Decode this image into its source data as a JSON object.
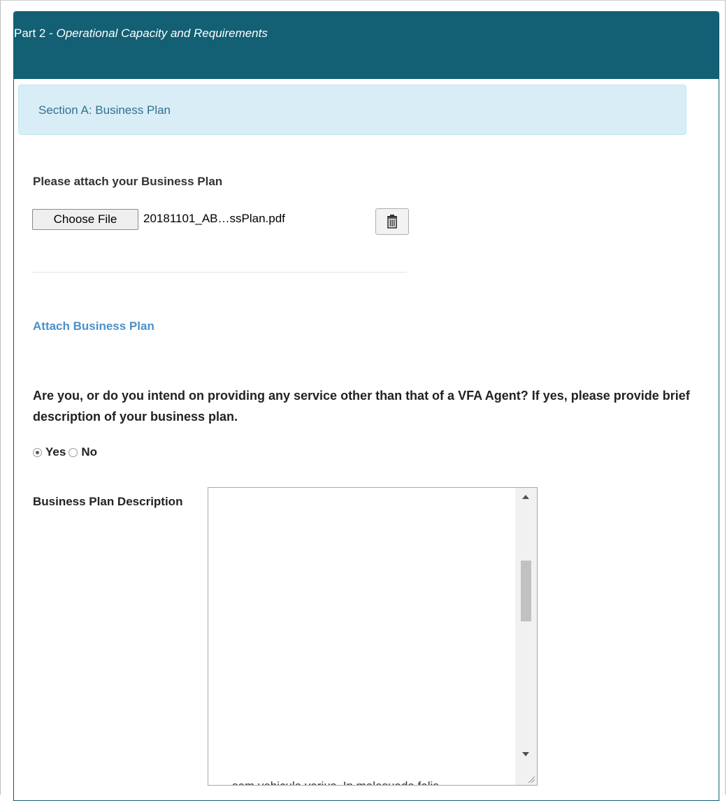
{
  "panel": {
    "heading_prefix": "Part 2 - ",
    "heading_title": "Operational Capacity and Requirements"
  },
  "section": {
    "title": "Section A: Business Plan"
  },
  "attach": {
    "prompt": "Please attach your Business Plan",
    "choose_file_label": "Choose File",
    "file_name": "20181101_AB…ssPlan.pdf",
    "delete_icon": "trash-icon",
    "link_text": "Attach Business Plan"
  },
  "question": {
    "text": "Are you, or do you intend on providing any service other than that of a VFA Agent? If yes, please provide brief description of your business plan.",
    "options": [
      {
        "label": "Yes",
        "selected": true
      },
      {
        "label": "No",
        "selected": false
      }
    ]
  },
  "description": {
    "label": "Business Plan Description",
    "visible_partial_text": "sem vehicula varius. In malesuada felis"
  },
  "colors": {
    "header_bg": "#135f73",
    "alert_bg": "#d9edf7",
    "alert_text": "#31708f",
    "link": "#4a90c9"
  }
}
